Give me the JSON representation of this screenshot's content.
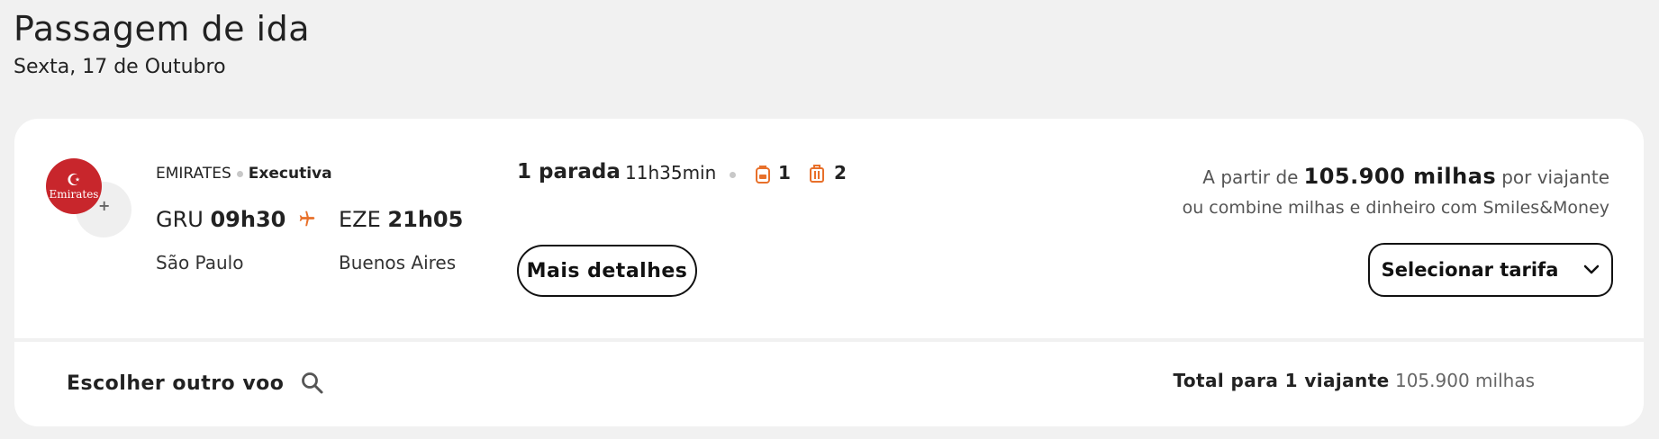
{
  "header": {
    "title": "Passagem de ida",
    "date": "Sexta, 17 de Outubro"
  },
  "flight": {
    "airline": "EMIRATES",
    "cabin": "Executiva",
    "logo_text": "Emirates",
    "origin_code": "GRU",
    "origin_time": "09h30",
    "destination_code": "EZE",
    "destination_time": "21h05",
    "origin_city": "São Paulo",
    "destination_city": "Buenos Aires",
    "stops": "1 parada",
    "duration": "11h35min",
    "carry_on_count": "1",
    "checked_bag_count": "2",
    "details_button": "Mais detalhes"
  },
  "price": {
    "prefix": "A partir de",
    "value": "105.900 milhas",
    "suffix": "por viajante",
    "combine": "ou combine milhas e dinheiro com Smiles&Money",
    "select_button": "Selecionar tarifa"
  },
  "footer": {
    "other_flight": "Escolher outro voo",
    "total_label": "Total para 1 viajante",
    "total_value": "105.900 milhas"
  },
  "colors": {
    "accent": "#e8702a",
    "airline_red": "#c8262c",
    "background": "#f1f1f1"
  },
  "icons": {
    "plane": "plane-icon",
    "carry_on": "backpack-icon",
    "checked_bag": "suitcase-icon",
    "chevron": "chevron-down-icon",
    "search": "search-icon"
  }
}
